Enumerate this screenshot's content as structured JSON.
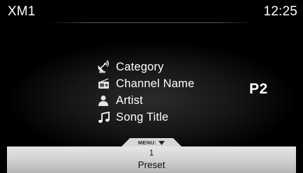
{
  "header": {
    "source": "XM1",
    "clock": "12:25"
  },
  "info": {
    "items": [
      {
        "icon": "satellite-dish-icon",
        "label": "Category"
      },
      {
        "icon": "radio-icon",
        "label": "Channel Name"
      },
      {
        "icon": "person-icon",
        "label": "Artist"
      },
      {
        "icon": "music-note-icon",
        "label": "Song Title"
      }
    ]
  },
  "preset": {
    "current": "P2"
  },
  "menu": {
    "label": "MENU:"
  },
  "bottom_bar": {
    "number": "1",
    "label": "Preset"
  }
}
